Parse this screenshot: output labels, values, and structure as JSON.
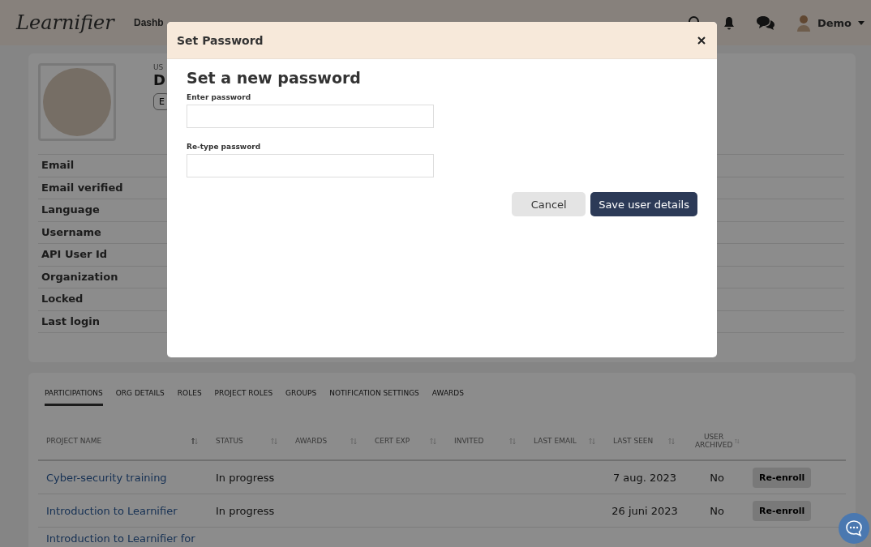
{
  "nav": {
    "logo": "Learnifier",
    "items": [
      "Dashb"
    ],
    "user": "Demo"
  },
  "profile": {
    "label": "US",
    "name": "D",
    "edit": "E",
    "fields": [
      "Email",
      "Email verified",
      "Language",
      "Username",
      "API User Id",
      "Organization",
      "Locked",
      "Last login"
    ]
  },
  "tabs": [
    {
      "label": "PARTICIPATIONS",
      "selected": true
    },
    {
      "label": "ORG DETAILS",
      "selected": false
    },
    {
      "label": "ROLES",
      "selected": false
    },
    {
      "label": "PROJECT ROLES",
      "selected": false
    },
    {
      "label": "GROUPS",
      "selected": false
    },
    {
      "label": "NOTIFICATION SETTINGS",
      "selected": false
    },
    {
      "label": "AWARDS",
      "selected": false
    }
  ],
  "table": {
    "columns": [
      {
        "label": "PROJECT NAME",
        "sorted": true
      },
      {
        "label": "STATUS",
        "sorted": false
      },
      {
        "label": "AWARDS",
        "sorted": false
      },
      {
        "label": "CERT EXP",
        "sorted": false
      },
      {
        "label": "INVITED",
        "sorted": false
      },
      {
        "label": "LAST EMAIL",
        "sorted": false
      },
      {
        "label": "LAST SEEN",
        "sorted": false
      },
      {
        "label": "USER ARCHIVED",
        "sorted": false
      }
    ],
    "rows": [
      {
        "project": "Cyber-security training",
        "status": "In progress",
        "last_seen": "7 aug. 2023",
        "archived": "No",
        "action": "Re-enroll"
      },
      {
        "project": "Introduction to Learnifier",
        "status": "In progress",
        "last_seen": "26 juni 2023",
        "archived": "No",
        "action": "Re-enroll"
      },
      {
        "project": "Introduction to Learnifier for"
      }
    ]
  },
  "modal": {
    "title": "Set Password",
    "heading": "Set a new password",
    "fields": [
      {
        "label": "Enter password"
      },
      {
        "label": "Re-type password"
      }
    ],
    "buttons": [
      {
        "label": "Cancel",
        "kind": "secondary"
      },
      {
        "label": "Save user details",
        "kind": "primary"
      }
    ]
  }
}
